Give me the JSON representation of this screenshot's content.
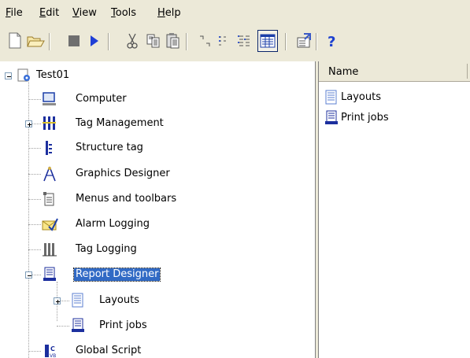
{
  "menu": [
    {
      "label": "File"
    },
    {
      "label": "Edit"
    },
    {
      "label": "View"
    },
    {
      "label": "Tools"
    },
    {
      "label": "Help"
    }
  ],
  "toolbar": {
    "buttons": [
      {
        "icon": "new-document-icon"
      },
      {
        "icon": "open-folder-icon"
      },
      {
        "icon": "stop-icon"
      },
      {
        "icon": "run-icon"
      },
      {
        "icon": "cut-icon"
      },
      {
        "icon": "copy-icon"
      },
      {
        "icon": "paste-icon"
      },
      {
        "icon": "large-icons-view-icon"
      },
      {
        "icon": "small-icons-view-icon"
      },
      {
        "icon": "list-view-icon"
      },
      {
        "icon": "details-view-icon",
        "pressed": true
      },
      {
        "icon": "properties-icon"
      },
      {
        "icon": "help-icon"
      }
    ]
  },
  "tree": {
    "root": {
      "label": "Test01",
      "icon": "project-icon",
      "expanded": true
    },
    "items": [
      {
        "label": "Computer",
        "icon": "computer-icon"
      },
      {
        "label": "Tag Management",
        "icon": "tag-management-icon",
        "expandable": true
      },
      {
        "label": "Structure tag",
        "icon": "structure-tag-icon"
      },
      {
        "label": "Graphics Designer",
        "icon": "graphics-designer-icon"
      },
      {
        "label": "Menus and toolbars",
        "icon": "menus-toolbars-icon"
      },
      {
        "label": "Alarm Logging",
        "icon": "alarm-logging-icon"
      },
      {
        "label": "Tag Logging",
        "icon": "tag-logging-icon"
      },
      {
        "label": "Report Designer",
        "icon": "report-designer-icon",
        "expanded": true,
        "selected": true,
        "children": [
          {
            "label": "Layouts",
            "icon": "layouts-icon",
            "expandable": true
          },
          {
            "label": "Print jobs",
            "icon": "print-jobs-icon"
          }
        ]
      },
      {
        "label": "Global Script",
        "icon": "global-script-icon"
      }
    ]
  },
  "list": {
    "column_header": "Name",
    "items": [
      {
        "label": "Layouts",
        "icon": "layouts-icon"
      },
      {
        "label": "Print jobs",
        "icon": "print-jobs-icon"
      }
    ]
  },
  "colors": {
    "selection": "#316ac5",
    "window_bg": "#ece9d8",
    "pane_bg": "#ffffff",
    "accent_blue": "#0033cc",
    "help_blue": "#1c40d0"
  }
}
